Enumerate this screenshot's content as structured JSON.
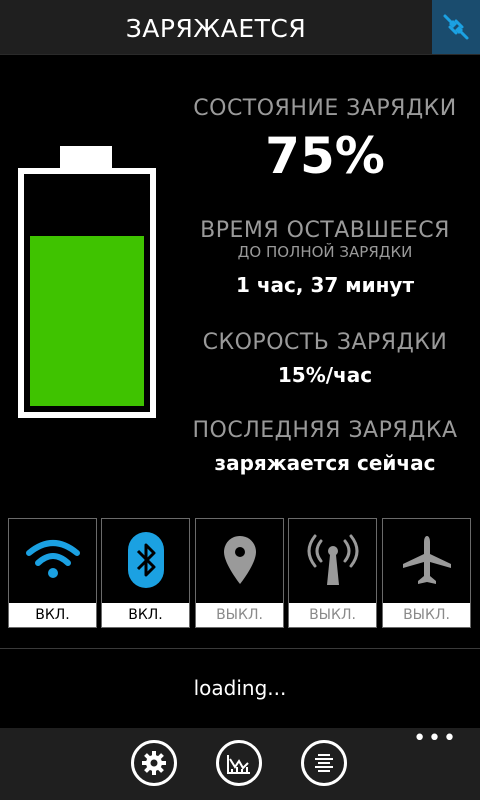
{
  "header": {
    "title": "ЗАРЯЖАЕТСЯ",
    "action_icon": "plug-icon"
  },
  "battery": {
    "level_percent": 75,
    "fill_color": "#3fc300"
  },
  "status": {
    "charge_label": "СОСТОЯНИЕ ЗАРЯДКИ",
    "charge_value": "75%",
    "time_label": "ВРЕМЯ ОСТАВШЕЕСЯ",
    "time_sublabel": "ДО ПОЛНОЙ ЗАРЯДКИ",
    "time_value": "1 час, 37 минут",
    "speed_label": "СКОРОСТЬ ЗАРЯДКИ",
    "speed_value": "15%/час",
    "last_label": "ПОСЛЕДНЯЯ ЗАРЯДКА",
    "last_value": "заряжается сейчас"
  },
  "toggles": [
    {
      "name": "wifi",
      "icon": "wifi-icon",
      "state": "ВКЛ.",
      "on": true
    },
    {
      "name": "bluetooth",
      "icon": "bluetooth-icon",
      "state": "ВКЛ.",
      "on": true
    },
    {
      "name": "location",
      "icon": "location-pin-icon",
      "state": "ВЫКЛ.",
      "on": false
    },
    {
      "name": "cellular",
      "icon": "antenna-icon",
      "state": "ВЫКЛ.",
      "on": false
    },
    {
      "name": "airplane",
      "icon": "airplane-icon",
      "state": "ВЫКЛ.",
      "on": false
    }
  ],
  "loading_text": "loading...",
  "appbar": {
    "buttons": [
      "settings-icon",
      "chart-icon",
      "list-icon"
    ],
    "more_label": "•••"
  },
  "colors": {
    "accent_blue": "#1ba1e2",
    "off_gray": "#9a9a9a",
    "battery_green": "#3fc300"
  }
}
